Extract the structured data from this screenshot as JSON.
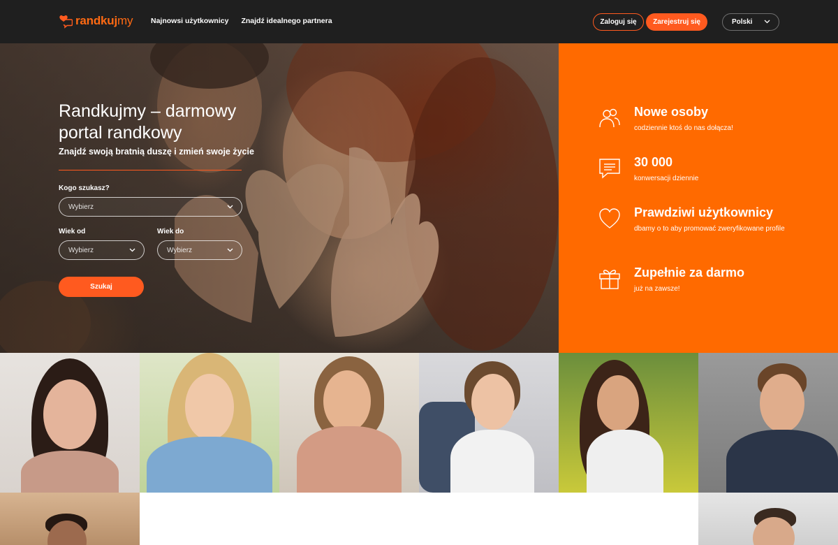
{
  "header": {
    "logo_text_bold": "randkuj",
    "logo_text_light": "my",
    "nav": [
      "Najnowsi użytkownicy",
      "Znajdź idealnego partnera"
    ],
    "login_label": "Zaloguj się",
    "register_label": "Zarejestruj się",
    "language": "Polski"
  },
  "hero": {
    "title": "Randkujmy – darmowy portal randkowy",
    "subtitle": "Znajdź swoją bratnią duszę i zmień swoje życie",
    "who_label": "Kogo szukasz?",
    "who_value": "Wybierz",
    "age_from_label": "Wiek od",
    "age_from_value": "Wybierz",
    "age_to_label": "Wiek do",
    "age_to_value": "Wybierz",
    "search_label": "Szukaj"
  },
  "features": [
    {
      "icon": "people-icon",
      "title": "Nowe osoby",
      "desc": "codziennie ktoś do nas dołącza!"
    },
    {
      "icon": "chat-icon",
      "title": "30 000",
      "desc": "konwersacji dziennie"
    },
    {
      "icon": "heart-icon",
      "title": "Prawdziwi użytkownicy",
      "desc": "dbamy o to aby promować zweryfikowane profile"
    },
    {
      "icon": "gift-icon",
      "title": "Zupełnie za darmo",
      "desc": "już na zawsze!"
    }
  ],
  "colors": {
    "accent": "#ff5a1f",
    "panel": "#ff6a00",
    "header_bg": "#1f1f1f"
  }
}
